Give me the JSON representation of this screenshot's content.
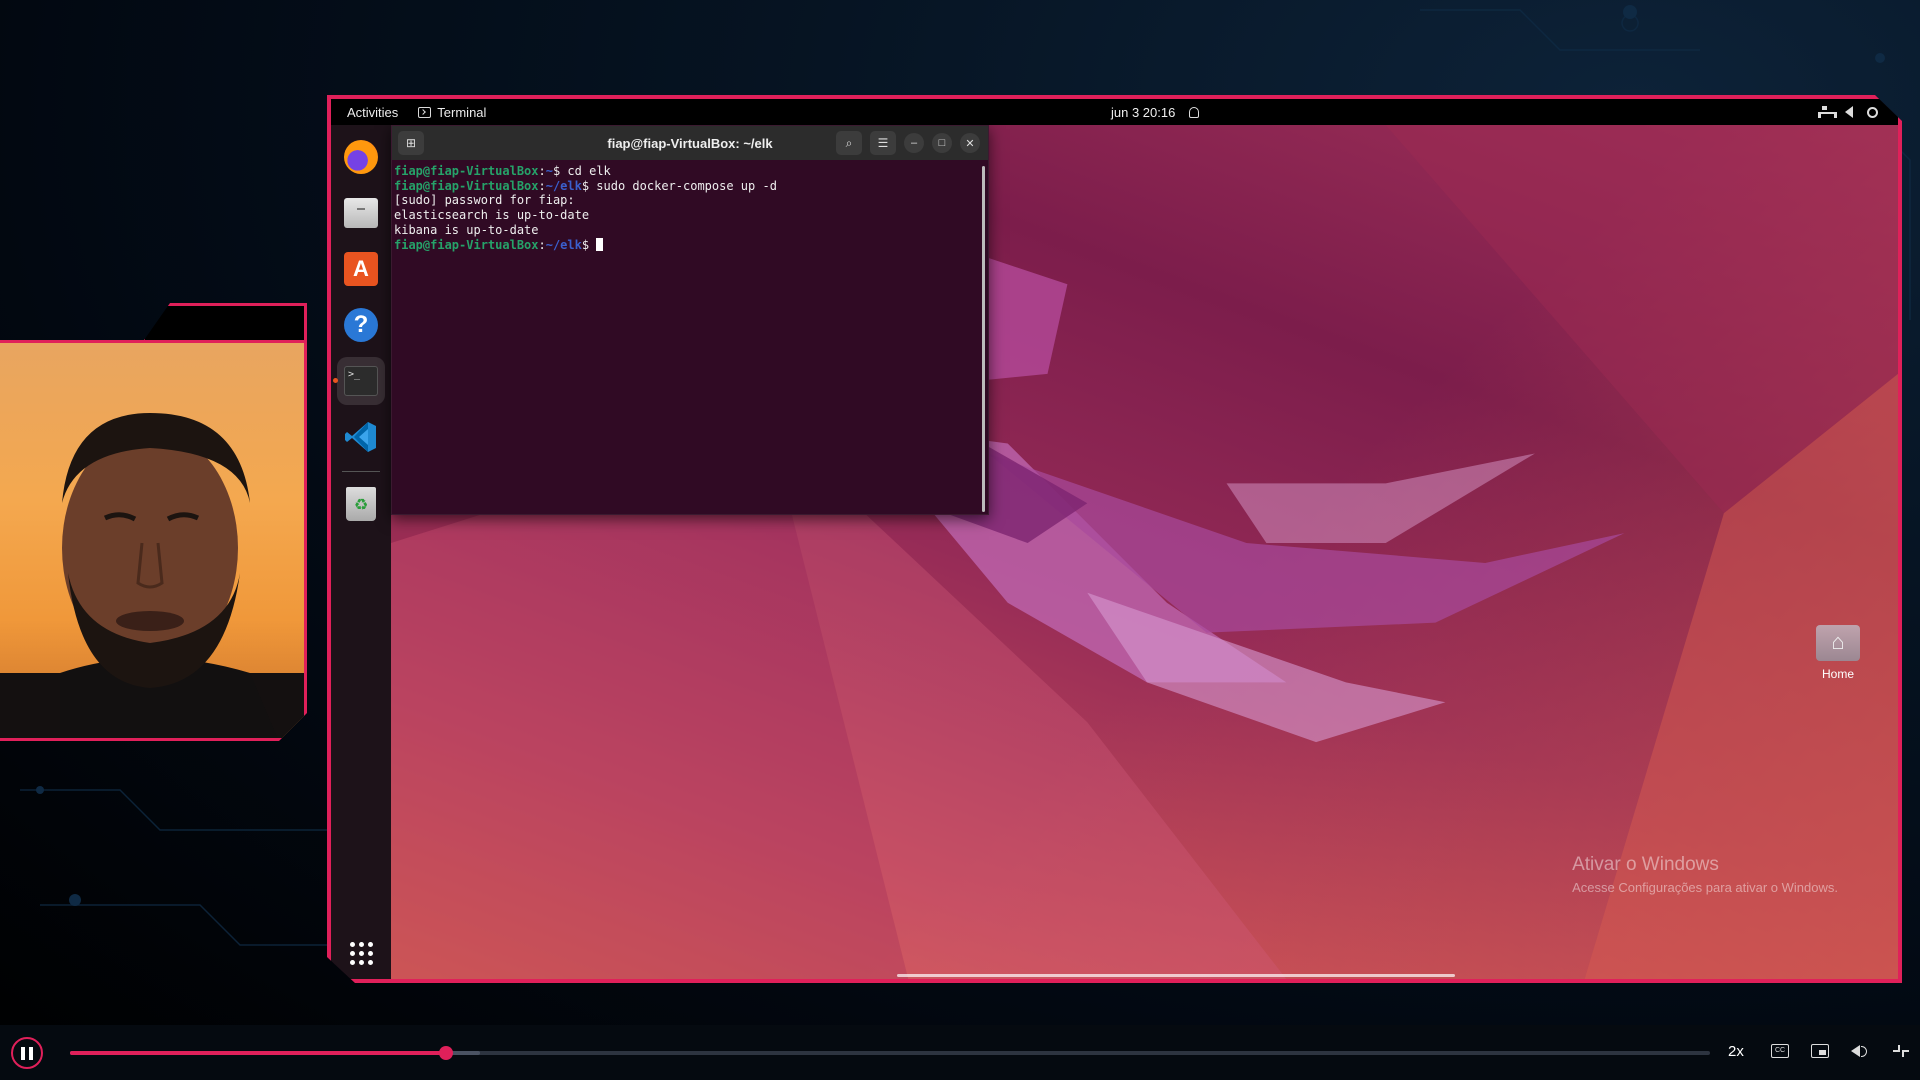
{
  "topbar": {
    "activities": "Activities",
    "app_name": "Terminal",
    "clock": "jun 3  20:16"
  },
  "dock": {
    "items": [
      "firefox",
      "files",
      "app-store",
      "help",
      "terminal",
      "vscode",
      "trash"
    ],
    "active": "terminal"
  },
  "terminal": {
    "title": "fiap@fiap-VirtualBox: ~/elk",
    "lines": [
      {
        "user": "fiap@fiap-VirtualBox",
        "path": "~",
        "cmd": "$ cd elk"
      },
      {
        "user": "fiap@fiap-VirtualBox",
        "path": "~/elk",
        "cmd": "$ sudo docker-compose up -d"
      },
      {
        "text": "[sudo] password for fiap:"
      },
      {
        "text": "elasticsearch is up-to-date"
      },
      {
        "text": "kibana is up-to-date"
      },
      {
        "user": "fiap@fiap-VirtualBox",
        "path": "~/elk",
        "cmd": "$ "
      }
    ]
  },
  "desktop": {
    "home_label": "Home"
  },
  "watermark": {
    "line1": "Ativar o Windows",
    "line2": "Acesse Configurações para ativar o Windows."
  },
  "player": {
    "progress": 0.229,
    "buffered": 0.25,
    "speed": "2x"
  },
  "colors": {
    "accent": "#e0205a",
    "terminal_bg": "#300a24",
    "prompt_user": "#26a269",
    "prompt_path": "#3a5fcd"
  }
}
